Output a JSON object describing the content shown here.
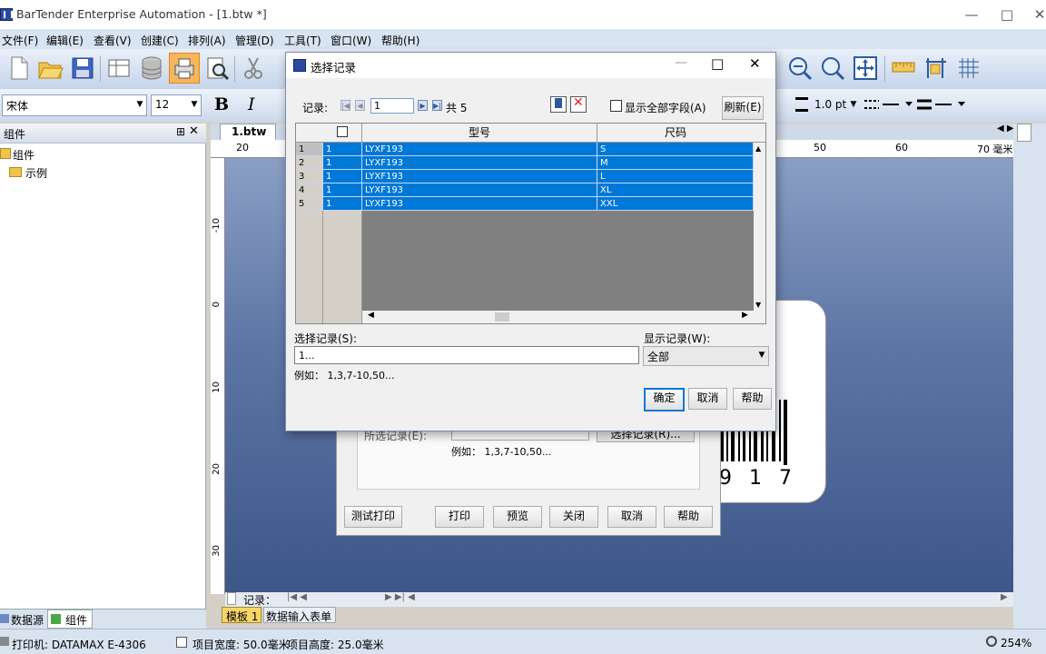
{
  "window": {
    "title": "BarTender Enterprise Automation - [1.btw *]"
  },
  "menu": [
    "文件(F)",
    "编辑(E)",
    "查看(V)",
    "创建(C)",
    "排列(A)",
    "管理(D)",
    "工具(T)",
    "窗口(W)",
    "帮助(H)"
  ],
  "format_toolbar": {
    "font": "宋体",
    "size": "12",
    "bold": "B",
    "italic": "I",
    "line_width": "1.0 pt"
  },
  "left_pane": {
    "header": "组件",
    "tree": [
      {
        "label": "组件"
      },
      {
        "label": "示例"
      }
    ],
    "bottom_tabs": [
      "数据源",
      "组件"
    ]
  },
  "doc_tab": "1.btw *",
  "ruler": {
    "top": [
      "20",
      "50",
      "60",
      "70 毫米"
    ],
    "left": [
      "-10",
      "0",
      "10",
      "20",
      "30"
    ]
  },
  "label_preview": {
    "barcode_digits": "9 1 7"
  },
  "canvas_nav": {
    "record_label": "记录："
  },
  "sheet_tabs": [
    "模板 1",
    "数据输入表单"
  ],
  "print_dialog": {
    "selected_records_label": "所选记录(E):",
    "select_records_button": "选择记录(R)...",
    "example": "例如：  1,3,7-10,50...",
    "buttons": [
      "测试打印",
      "打印",
      "预览",
      "关闭",
      "取消",
      "帮助"
    ]
  },
  "select_dialog": {
    "title": "选择记录",
    "record_label": "记录:",
    "record_value": "1",
    "total": "共 5",
    "show_all_fields": "显示全部字段(A)",
    "refresh": "刷新(E)",
    "columns": [
      "型号",
      "尺码"
    ],
    "rows": [
      {
        "n": "1",
        "sel": "1",
        "model": "LYXF193",
        "size": "S"
      },
      {
        "n": "2",
        "sel": "1",
        "model": "LYXF193",
        "size": "M"
      },
      {
        "n": "3",
        "sel": "1",
        "model": "LYXF193",
        "size": "L"
      },
      {
        "n": "4",
        "sel": "1",
        "model": "LYXF193",
        "size": "XL"
      },
      {
        "n": "5",
        "sel": "1",
        "model": "LYXF193",
        "size": "XXL"
      }
    ],
    "select_label": "选择记录(S):",
    "select_value": "1...",
    "show_label": "显示记录(W):",
    "show_value": "全部",
    "example": "例如：  1,3,7-10,50...",
    "ok": "确定",
    "cancel": "取消",
    "help": "帮助"
  },
  "status": {
    "printer": "打印机: DATAMAX E-4306",
    "width": "项目宽度: 50.0毫米",
    "height": "项目高度: 25.0毫米",
    "zoom": "254%"
  },
  "colors": {
    "selection": "#0078d7",
    "menu_bg": "#d9e4f2",
    "canvas": "#5e76a6"
  }
}
